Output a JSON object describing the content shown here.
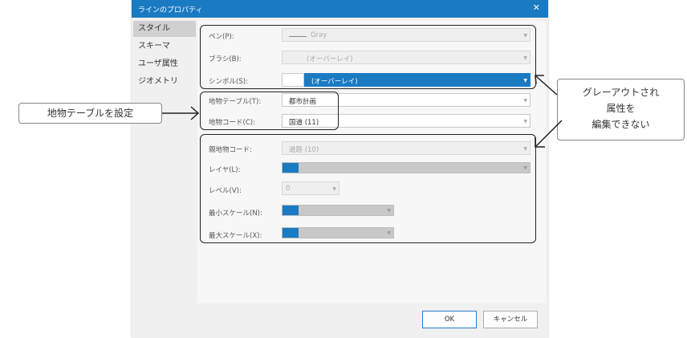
{
  "dialog": {
    "title": "ラインのプロパティ",
    "close": "✕"
  },
  "nav": {
    "items": [
      "スタイル",
      "スキーマ",
      "ユーザ属性",
      "ジオメトリ"
    ]
  },
  "style_group": {
    "pen_label": "ペン(P):",
    "pen_value": "Gray",
    "brush_label": "ブラシ(B):",
    "brush_value": "(オーバーレイ)",
    "symbol_label": "シンボル(S):",
    "symbol_value": "(オーバーレイ)"
  },
  "feature_group": {
    "table_label": "地物テーブル(T):",
    "table_value": "都市計画",
    "code_label": "地物コード(C):",
    "code_value": "国道 (11)"
  },
  "parent_group": {
    "parent_code_label": "親地物コード:",
    "parent_code_value": "道路 (10)",
    "layer_label": "レイヤ(L):",
    "level_label": "レベル(V):",
    "level_value": "0",
    "min_scale_label": "最小スケール(N):",
    "max_scale_label": "最大スケール(X):"
  },
  "buttons": {
    "ok": "OK",
    "cancel": "キャンセル"
  },
  "annotations": {
    "left": "地物テーブルを設定",
    "right_lines": [
      "グレーアウトされ",
      "属性を",
      "編集できない"
    ]
  },
  "colors": {
    "accent": "#1a7ac2",
    "panel": "#f7f7f7",
    "disabled": "#efefef"
  },
  "icons": {
    "dropdown": "chevron-down-icon",
    "close": "close-icon"
  }
}
